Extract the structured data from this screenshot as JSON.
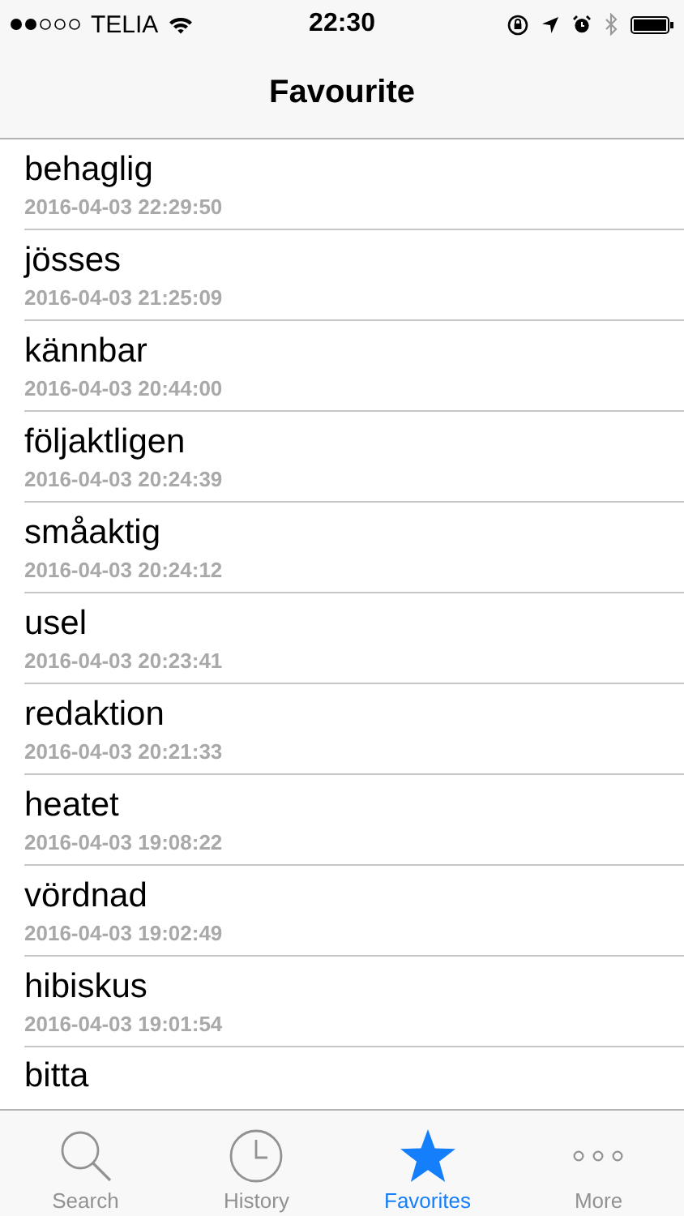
{
  "status_bar": {
    "carrier": "TELIA",
    "time": "22:30"
  },
  "nav": {
    "title": "Favourite"
  },
  "favorites": [
    {
      "word": "behaglig",
      "date": "2016-04-03 22:29:50"
    },
    {
      "word": "jösses",
      "date": "2016-04-03 21:25:09"
    },
    {
      "word": "kännbar",
      "date": "2016-04-03 20:44:00"
    },
    {
      "word": "följaktligen",
      "date": "2016-04-03 20:24:39"
    },
    {
      "word": "småaktig",
      "date": "2016-04-03 20:24:12"
    },
    {
      "word": "usel",
      "date": "2016-04-03 20:23:41"
    },
    {
      "word": "redaktion",
      "date": "2016-04-03 20:21:33"
    },
    {
      "word": "heatet",
      "date": "2016-04-03 19:08:22"
    },
    {
      "word": "vördnad",
      "date": "2016-04-03 19:02:49"
    },
    {
      "word": "hibiskus",
      "date": "2016-04-03 19:01:54"
    },
    {
      "word": "bitta"
    }
  ],
  "tabs": [
    {
      "kind": "search",
      "label": "Search",
      "selected": false
    },
    {
      "kind": "history",
      "label": "History",
      "selected": false
    },
    {
      "kind": "favorites",
      "label": "Favorites",
      "selected": true
    },
    {
      "kind": "more",
      "label": "More",
      "selected": false
    }
  ]
}
